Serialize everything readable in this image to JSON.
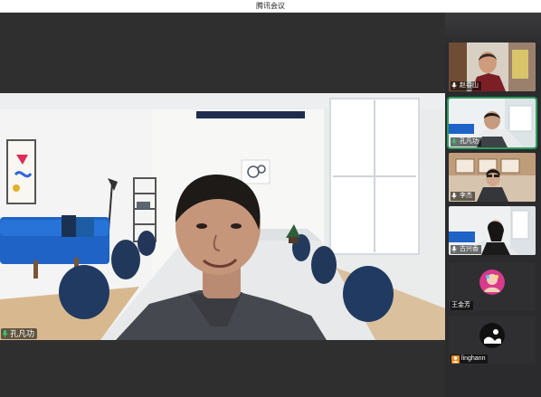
{
  "window": {
    "title": "腾讯会议"
  },
  "main": {
    "speaker_name": "孔凡功"
  },
  "participants": [
    {
      "name": "赵春山"
    },
    {
      "name": "孔凡功"
    },
    {
      "name": "李杰"
    },
    {
      "name": "古兴香"
    },
    {
      "name": "王金芳"
    },
    {
      "name": "linghann"
    }
  ],
  "colors": {
    "active_outline": "#2a9d5d",
    "mic_icon": "#35c76c",
    "user_icon": "#e58a22"
  }
}
